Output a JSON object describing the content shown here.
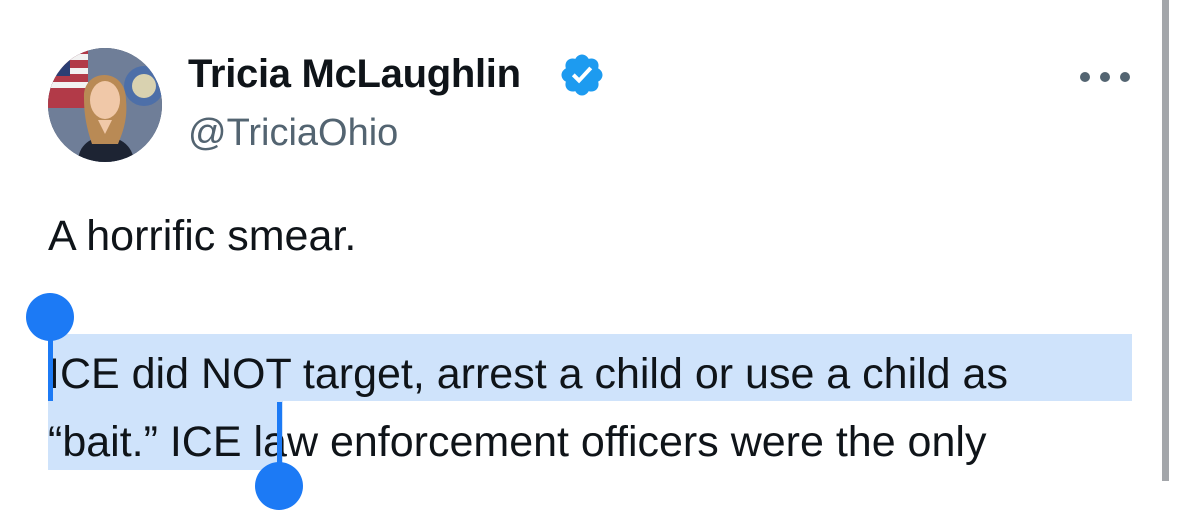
{
  "tweet": {
    "author": {
      "display_name": "Tricia McLaughlin",
      "handle": "@TriciaOhio",
      "verified": true
    },
    "more_icon": "more-horizontal-icon",
    "text": {
      "line1": "A horrific smear.",
      "line2": "ICE did NOT target, arrest a child or use a child as",
      "line3": "“bait.”  ICE law enforcement officers were the only"
    }
  },
  "colors": {
    "verified_badge": "#1d9bf0",
    "selection_highlight": "#cfe3fb",
    "selection_handle": "#1c7af5",
    "handle_text": "#536471"
  }
}
